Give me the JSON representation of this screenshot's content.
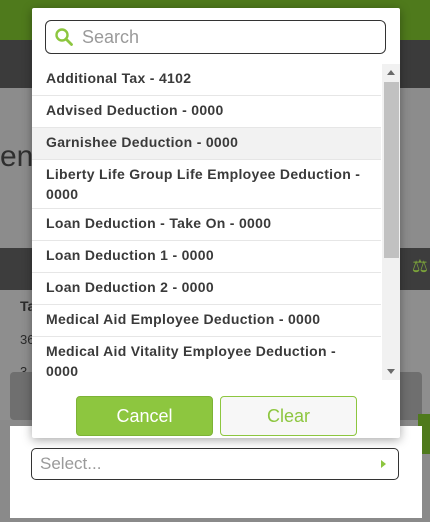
{
  "background": {
    "title_fragment": "en",
    "column_label": "Ta",
    "row1": "36",
    "row2": "3"
  },
  "dropdown": {
    "search": {
      "placeholder": "Search",
      "icon": "search-icon"
    },
    "items": [
      {
        "label": "Additional Tax - 4102"
      },
      {
        "label": "Advised Deduction - 0000"
      },
      {
        "label": "Garnishee Deduction - 0000"
      },
      {
        "label": "Liberty Life Group Life Employee Deduction - 0000"
      },
      {
        "label": "Loan Deduction - Take On - 0000"
      },
      {
        "label": "Loan Deduction 1 - 0000"
      },
      {
        "label": "Loan Deduction 2 - 0000"
      },
      {
        "label": "Medical Aid Employee Deduction - 0000"
      },
      {
        "label": "Medical Aid Vitality Employee Deduction - 0000"
      }
    ],
    "highlighted_index": 2,
    "cancel_label": "Cancel",
    "clear_label": "Clear"
  },
  "select": {
    "placeholder": "Select..."
  },
  "colors": {
    "accent": "#8dc63f",
    "dark_green": "#4f7a1c"
  }
}
